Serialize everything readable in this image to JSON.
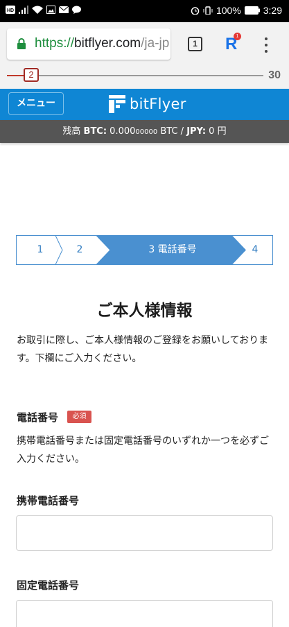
{
  "status_bar": {
    "left_icons": [
      "hd-icon",
      "signal-icon",
      "wifi-icon",
      "image-icon",
      "mail-icon",
      "chat-icon"
    ],
    "right_icons": [
      "alarm-icon",
      "vibrate-icon"
    ],
    "battery": "100%",
    "time": "3:29"
  },
  "browser": {
    "url_scheme": "https://",
    "url_host": "bitflyer.com",
    "url_path": "/ja-jp",
    "tab_count": "1",
    "extension_badge": "1"
  },
  "progress": {
    "current": "2",
    "total": "30",
    "fraction": 0.067
  },
  "header": {
    "menu_label": "メニュー",
    "logo_text": "bitFlyer"
  },
  "balance": {
    "prefix": "残高 ",
    "btc_label": "BTC:",
    "btc_value_main": " 0.000",
    "btc_value_small": "00000",
    "btc_unit": " BTC",
    "separator": "  /  ",
    "jpy_label": "JPY:",
    "jpy_value": " 0 円"
  },
  "steps": [
    {
      "label": "1"
    },
    {
      "label": "2"
    },
    {
      "label": "3 電話番号"
    },
    {
      "label": "4"
    }
  ],
  "title": "ご本人様情報",
  "intro": "お取引に際し、ご本人様情報のご登録をお願いしております。下欄にご入力ください。",
  "phone_section": {
    "label": "電話番号",
    "required": "必須",
    "note": "携帯電話番号または固定電話番号のいずれか一つを必ずご入力ください。"
  },
  "mobile": {
    "label": "携帯電話番号",
    "value": ""
  },
  "landline": {
    "label": "固定電話番号",
    "value": ""
  },
  "colors": {
    "brand_blue": "#0f86d4",
    "step_active": "#4a90d0",
    "required_red": "#d9534f"
  }
}
